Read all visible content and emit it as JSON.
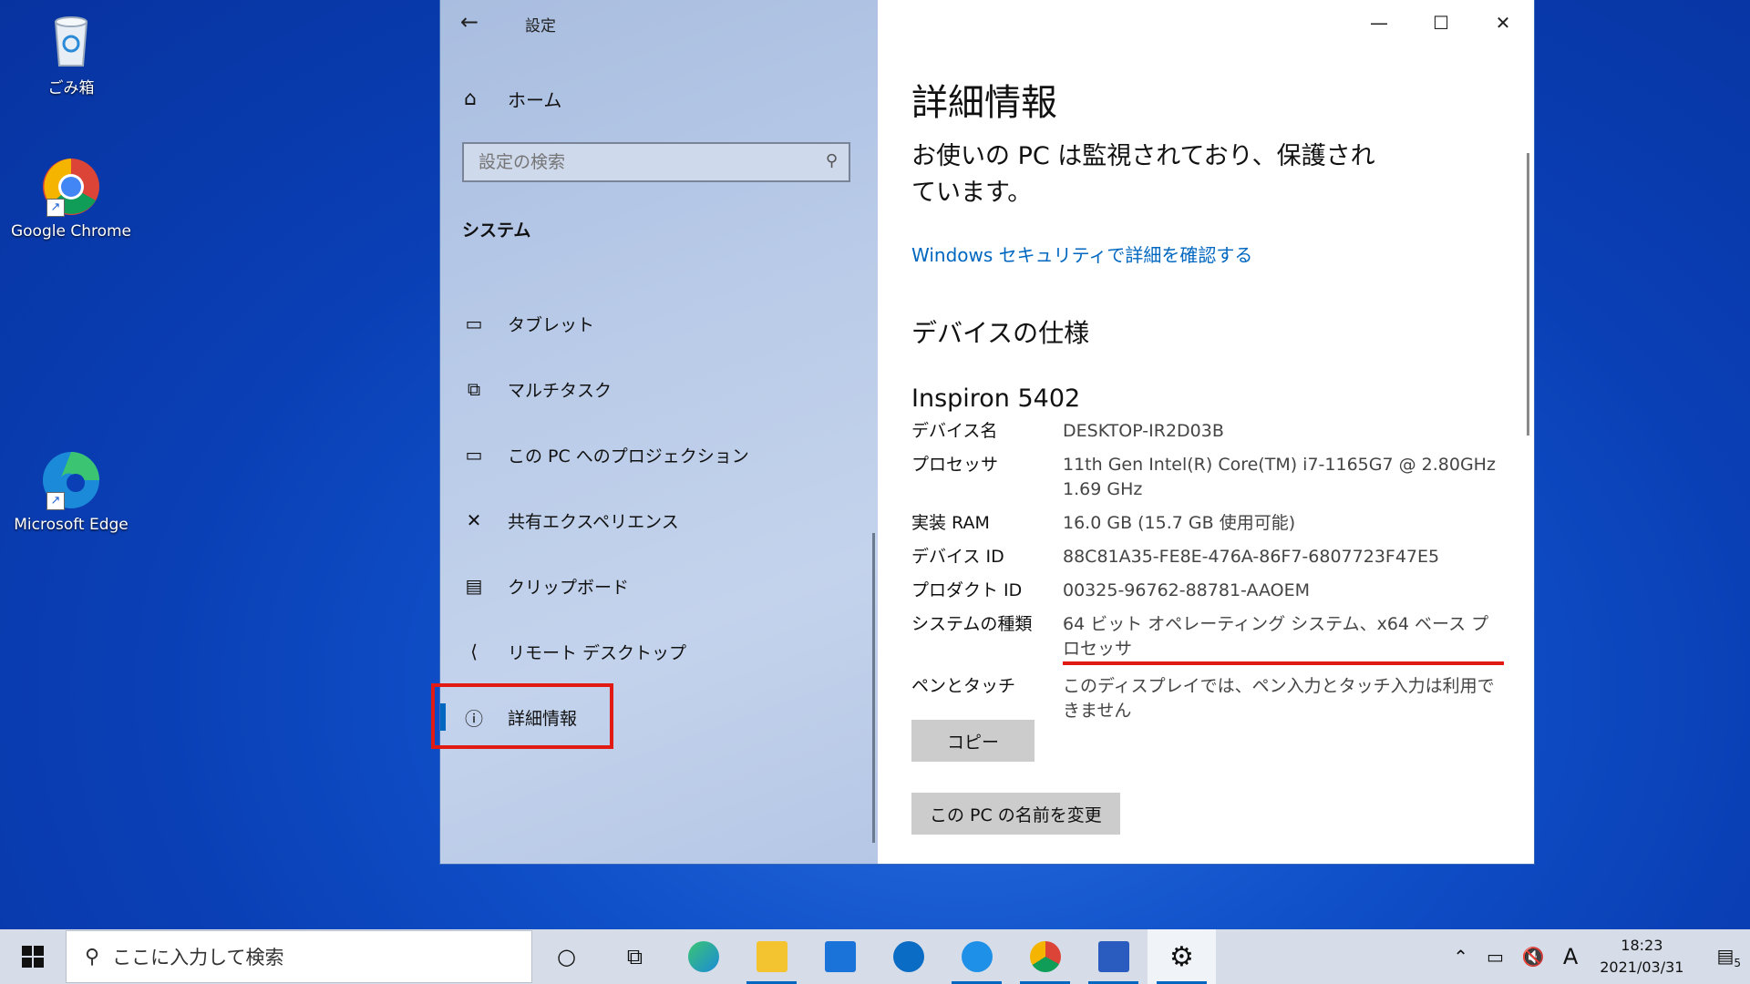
{
  "desktop": {
    "icons": [
      {
        "label": "ごみ箱",
        "icon": "recycle-bin-icon"
      },
      {
        "label": "Google Chrome",
        "icon": "chrome-icon"
      },
      {
        "label": "Microsoft Edge",
        "icon": "edge-icon"
      }
    ]
  },
  "window": {
    "title": "設定",
    "back_glyph": "←",
    "controls": {
      "minimize": "—",
      "maximize": "☐",
      "close": "✕"
    }
  },
  "sidebar": {
    "home_label": "ホーム",
    "search_placeholder": "設定の検索",
    "section_label": "システム",
    "items": [
      {
        "label": "タブレット",
        "icon": "tablet-icon"
      },
      {
        "label": "マルチタスク",
        "icon": "multitask-icon"
      },
      {
        "label": "この PC へのプロジェクション",
        "icon": "projection-icon"
      },
      {
        "label": "共有エクスペリエンス",
        "icon": "shared-experiences-icon"
      },
      {
        "label": "クリップボード",
        "icon": "clipboard-icon"
      },
      {
        "label": "リモート デスクトップ",
        "icon": "remote-desktop-icon"
      },
      {
        "label": "詳細情報",
        "icon": "info-icon",
        "active": true
      }
    ]
  },
  "main": {
    "title": "詳細情報",
    "protection_status": "お使いの PC は監視されており、保護されています。",
    "security_link": "Windows セキュリティで詳細を確認する",
    "device_specs_heading": "デバイスの仕様",
    "model": "Inspiron 5402",
    "specs": [
      {
        "key": "デバイス名",
        "value": "DESKTOP-IR2D03B"
      },
      {
        "key": "プロセッサ",
        "value": "11th Gen Intel(R) Core(TM) i7-1165G7 @ 2.80GHz 1.69 GHz"
      },
      {
        "key": "実装 RAM",
        "value": "16.0 GB (15.7 GB 使用可能)"
      },
      {
        "key": "デバイス ID",
        "value": "88C81A35-FE8E-476A-86F7-6807723F47E5"
      },
      {
        "key": "プロダクト ID",
        "value": "00325-96762-88781-AAOEM"
      },
      {
        "key": "システムの種類",
        "value": "64 ビット オペレーティング システム、x64 ベース プロセッサ"
      },
      {
        "key": "ペンとタッチ",
        "value": "このディスプレイでは、ペン入力とタッチ入力は利用できません"
      }
    ],
    "copy_button": "コピー",
    "rename_button": "この PC の名前を変更"
  },
  "taskbar": {
    "search_placeholder": "ここに入力して検索",
    "time": "18:23",
    "date": "2021/03/31",
    "ime": "A",
    "notification_count": "5"
  },
  "colors": {
    "accent": "#0067c0",
    "highlight": "#e21a14"
  }
}
